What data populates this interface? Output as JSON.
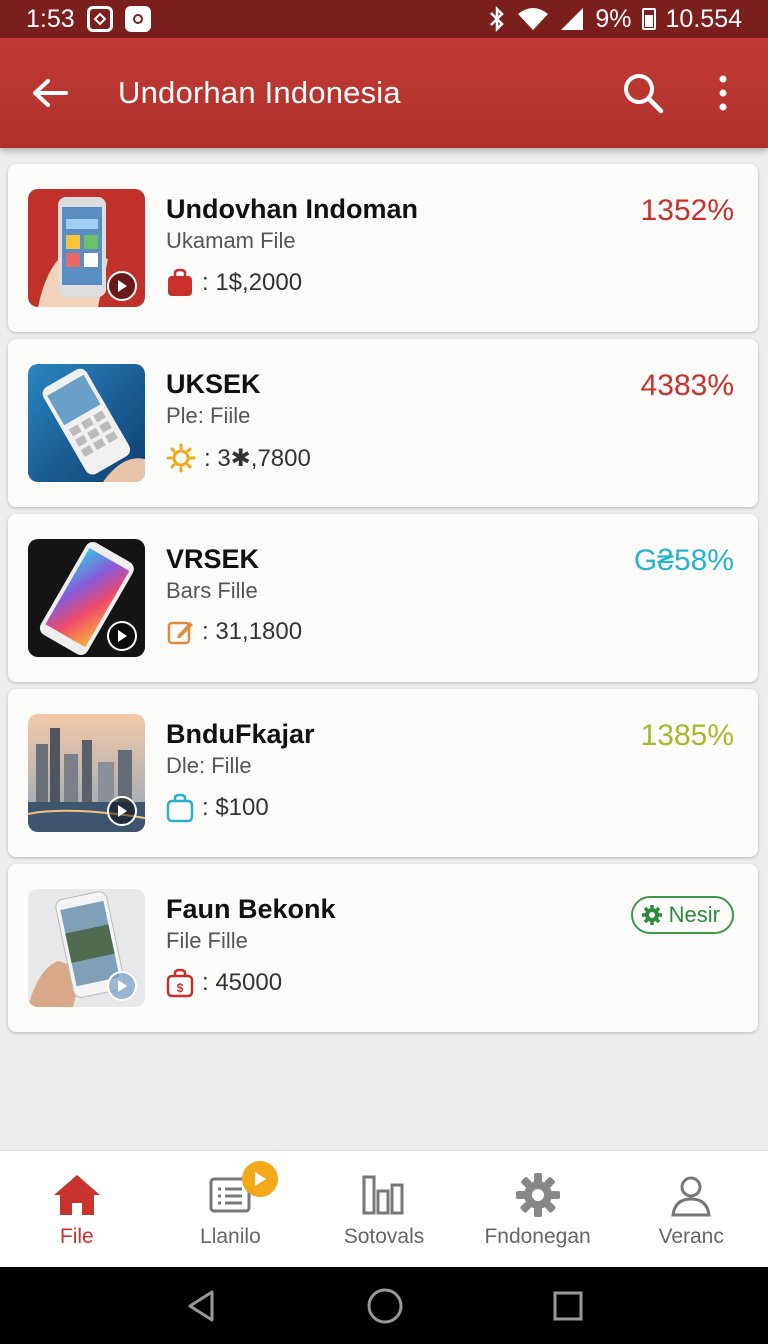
{
  "status_bar": {
    "time": "1:53",
    "battery_pct": "9%",
    "right_value": "10.554"
  },
  "app_bar": {
    "title": "Undorhan Indonesia",
    "icons": [
      "back-arrow-icon",
      "search-icon",
      "more-vert-icon"
    ]
  },
  "items": [
    {
      "name": "Undovhan Indoman",
      "subtitle": "Ukamam File",
      "meta_icon": "bag-icon",
      "meta_value": ": 1$,2000",
      "percent": "1352%",
      "percent_color": "#c9302c"
    },
    {
      "name": "UKSEK",
      "subtitle": "Ple: Fiile",
      "meta_icon": "sun-icon",
      "meta_value": ": 3✱,7800",
      "percent": "4383%",
      "percent_color": "#c9302c"
    },
    {
      "name": "VRSEK",
      "subtitle": "Bars Fille",
      "meta_icon": "edit-icon",
      "meta_value": ": 31,1800",
      "percent": "G₴58%",
      "percent_color": "#27b3c8"
    },
    {
      "name": "BnduFkajar",
      "subtitle": "Dle: Fille",
      "meta_icon": "bag-icon",
      "meta_value": ": $100",
      "percent": "1385%",
      "percent_color": "#a8b82e"
    },
    {
      "name": "Faun Bekonk",
      "subtitle": "File Fille",
      "meta_icon": "bag-icon",
      "meta_value": ": 45000",
      "badge": "Nesir",
      "badge_color": "#3a9a4a"
    }
  ],
  "bottom_nav": [
    {
      "label": "File",
      "icon": "home-icon",
      "active": true
    },
    {
      "label": "Llanilo",
      "icon": "list-icon",
      "active": false
    },
    {
      "label": "Sotovals",
      "icon": "chart-icon",
      "active": false
    },
    {
      "label": "Fndonegan",
      "icon": "gear-icon",
      "active": false
    },
    {
      "label": "Veranc",
      "icon": "person-icon",
      "active": false
    }
  ]
}
